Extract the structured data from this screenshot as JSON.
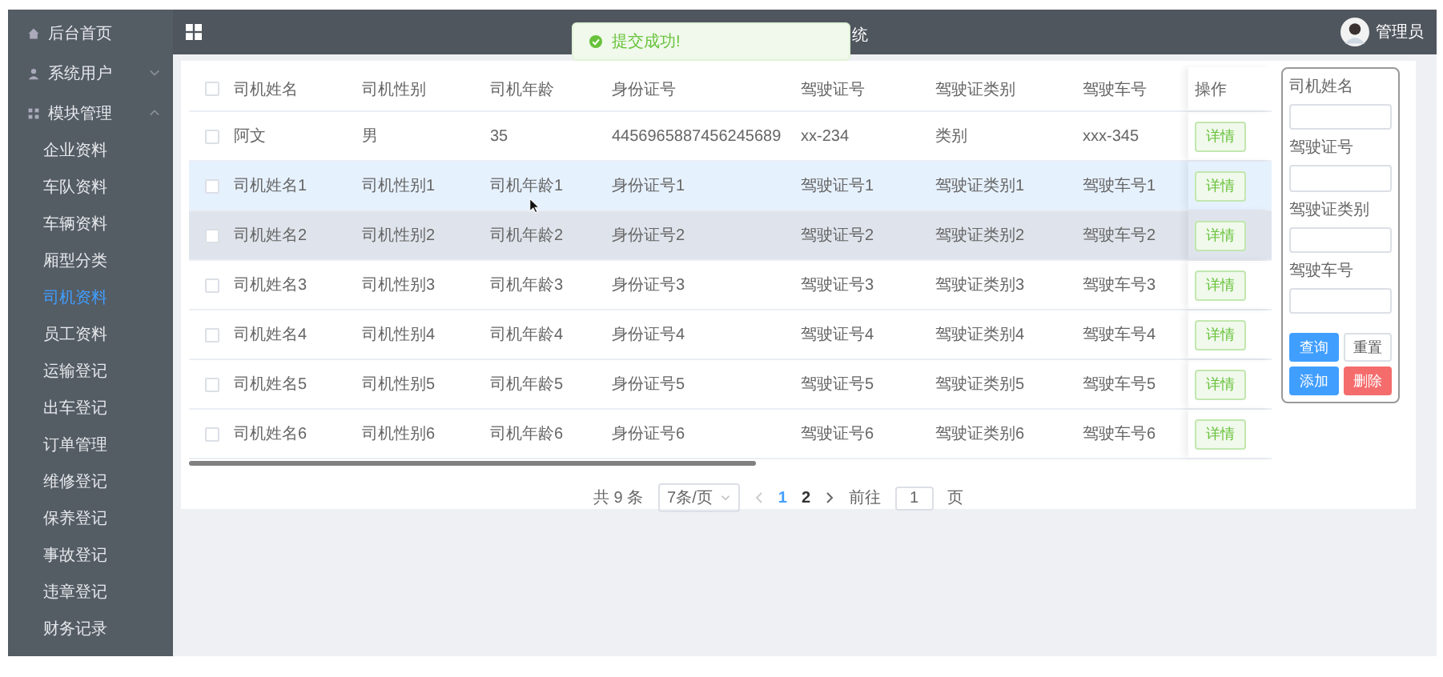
{
  "sidebar": {
    "items": [
      {
        "label": "后台首页"
      },
      {
        "label": "系统用户",
        "expanded": false
      },
      {
        "label": "模块管理",
        "expanded": true,
        "children": [
          {
            "label": "企业资料",
            "selected": false
          },
          {
            "label": "车队资料",
            "selected": false
          },
          {
            "label": "车辆资料",
            "selected": false
          },
          {
            "label": "厢型分类",
            "selected": false
          },
          {
            "label": "司机资料",
            "selected": true
          },
          {
            "label": "员工资料",
            "selected": false
          },
          {
            "label": "运输登记",
            "selected": false
          },
          {
            "label": "出车登记",
            "selected": false
          },
          {
            "label": "订单管理",
            "selected": false
          },
          {
            "label": "维修登记",
            "selected": false
          },
          {
            "label": "保养登记",
            "selected": false
          },
          {
            "label": "事故登记",
            "selected": false
          },
          {
            "label": "违章登记",
            "selected": false
          },
          {
            "label": "财务记录",
            "selected": false
          }
        ]
      }
    ]
  },
  "header": {
    "title_visible": "统",
    "user": "管理员"
  },
  "toast": {
    "text": "提交成功!"
  },
  "table": {
    "select_all_checked": false,
    "columns": [
      "司机姓名",
      "司机性别",
      "司机年龄",
      "身份证号",
      "驾驶证号",
      "驾驶证类别",
      "驾驶车号",
      "操作"
    ],
    "rows": [
      {
        "checked": false,
        "hovered": false,
        "current": false,
        "cells": [
          "阿文",
          "男",
          "35",
          "4456965887456245689",
          "xx-234",
          "类别",
          "xxx-345"
        ],
        "action": "详情"
      },
      {
        "checked": false,
        "hovered": true,
        "current": false,
        "cells": [
          "司机姓名1",
          "司机性别1",
          "司机年龄1",
          "身份证号1",
          "驾驶证号1",
          "驾驶证类别1",
          "驾驶车号1"
        ],
        "action": "详情"
      },
      {
        "checked": false,
        "hovered": false,
        "current": true,
        "cells": [
          "司机姓名2",
          "司机性别2",
          "司机年龄2",
          "身份证号2",
          "驾驶证号2",
          "驾驶证类别2",
          "驾驶车号2"
        ],
        "action": "详情"
      },
      {
        "checked": false,
        "hovered": false,
        "current": false,
        "cells": [
          "司机姓名3",
          "司机性别3",
          "司机年龄3",
          "身份证号3",
          "驾驶证号3",
          "驾驶证类别3",
          "驾驶车号3"
        ],
        "action": "详情"
      },
      {
        "checked": false,
        "hovered": false,
        "current": false,
        "cells": [
          "司机姓名4",
          "司机性别4",
          "司机年龄4",
          "身份证号4",
          "驾驶证号4",
          "驾驶证类别4",
          "驾驶车号4"
        ],
        "action": "详情"
      },
      {
        "checked": false,
        "hovered": false,
        "current": false,
        "cells": [
          "司机姓名5",
          "司机性别5",
          "司机年龄5",
          "身份证号5",
          "驾驶证号5",
          "驾驶证类别5",
          "驾驶车号5"
        ],
        "action": "详情"
      },
      {
        "checked": false,
        "hovered": false,
        "current": false,
        "cells": [
          "司机姓名6",
          "司机性别6",
          "司机年龄6",
          "身份证号6",
          "驾驶证号6",
          "驾驶证类别6",
          "驾驶车号6"
        ],
        "action": "详情"
      }
    ]
  },
  "pagination": {
    "total": "共 9 条",
    "page_size": "7条/页",
    "pages": [
      {
        "label": "1",
        "selected": true
      },
      {
        "label": "2",
        "selected": false
      }
    ],
    "goto_label": "前往",
    "goto_value": "1",
    "goto_suffix": "页"
  },
  "search_panel": {
    "fields": [
      {
        "label": "司机姓名"
      },
      {
        "label": "驾驶证号"
      },
      {
        "label": "驾驶证类别"
      },
      {
        "label": "驾驶车号"
      }
    ],
    "buttons": [
      {
        "label": "查询",
        "kind": "primary"
      },
      {
        "label": "重置",
        "kind": "default"
      },
      {
        "label": "添加",
        "kind": "primary"
      },
      {
        "label": "删除",
        "kind": "danger"
      }
    ]
  }
}
